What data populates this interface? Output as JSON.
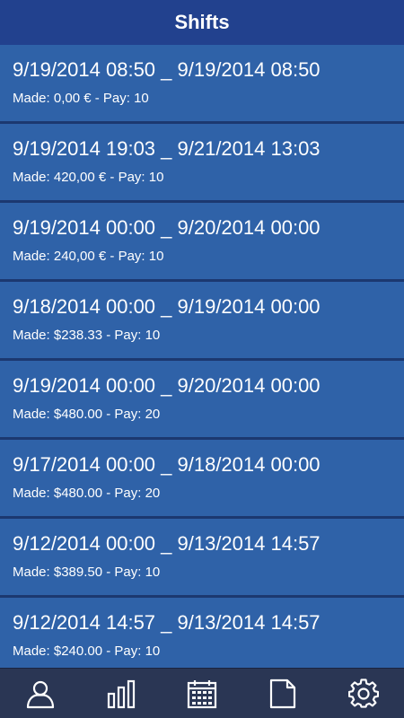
{
  "header": {
    "title": "Shifts"
  },
  "shifts": [
    {
      "range": "9/19/2014 08:50 _ 9/19/2014 08:50",
      "made": "Made: 0,00 € - Pay: 10"
    },
    {
      "range": "9/19/2014 19:03 _ 9/21/2014 13:03",
      "made": "Made: 420,00 € - Pay: 10"
    },
    {
      "range": "9/19/2014 00:00 _ 9/20/2014 00:00",
      "made": "Made: 240,00 € - Pay: 10"
    },
    {
      "range": "9/18/2014 00:00 _ 9/19/2014 00:00",
      "made": "Made: $238.33 - Pay: 10"
    },
    {
      "range": "9/19/2014 00:00 _ 9/20/2014 00:00",
      "made": "Made: $480.00 - Pay: 20"
    },
    {
      "range": "9/17/2014 00:00 _ 9/18/2014 00:00",
      "made": "Made: $480.00 - Pay: 20"
    },
    {
      "range": "9/12/2014 00:00 _ 9/13/2014 14:57",
      "made": "Made: $389.50 - Pay: 10"
    },
    {
      "range": "9/12/2014 14:57 _ 9/13/2014 14:57",
      "made": "Made: $240.00 - Pay: 10"
    }
  ],
  "tabbar": {
    "tabs": [
      {
        "icon": "person-icon"
      },
      {
        "icon": "bar-chart-icon"
      },
      {
        "icon": "calendar-icon"
      },
      {
        "icon": "document-icon"
      },
      {
        "icon": "gear-icon"
      }
    ]
  },
  "colors": {
    "header_bg": "#22418e",
    "row_bg": "#2f62a8",
    "tabbar_bg": "#2a3654",
    "text": "#ffffff"
  }
}
